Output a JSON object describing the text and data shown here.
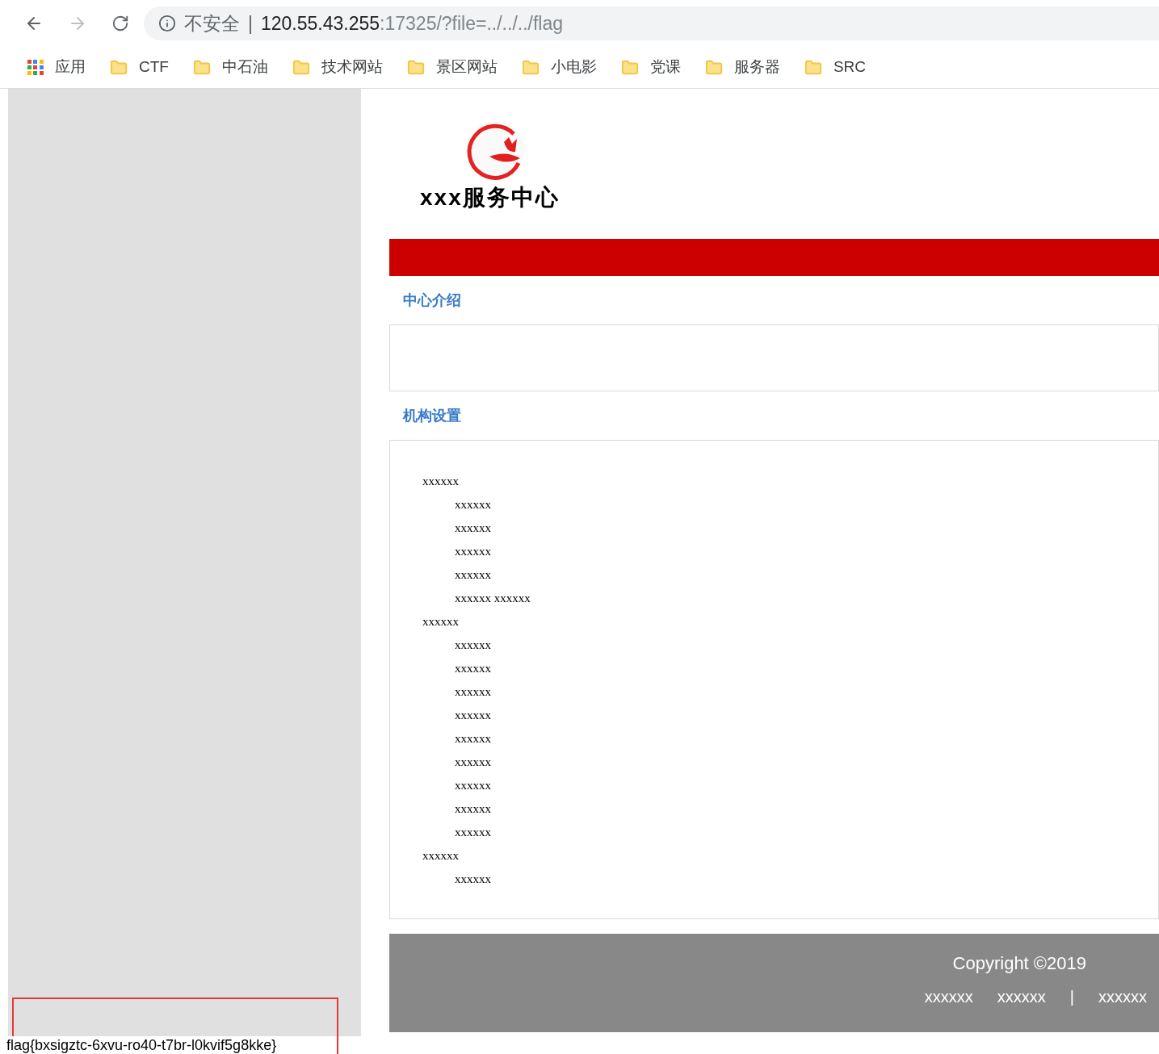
{
  "address_bar": {
    "security_label": "不安全",
    "separator": "|",
    "host": "120.55.43.255",
    "path": ":17325/?file=../../../flag"
  },
  "bookmarks": [
    {
      "label": "应用",
      "kind": "apps"
    },
    {
      "label": "CTF",
      "kind": "folder"
    },
    {
      "label": "中石油",
      "kind": "folder"
    },
    {
      "label": "技术网站",
      "kind": "folder"
    },
    {
      "label": "景区网站",
      "kind": "folder"
    },
    {
      "label": "小电影",
      "kind": "folder"
    },
    {
      "label": "党课",
      "kind": "folder"
    },
    {
      "label": "服务器",
      "kind": "folder"
    },
    {
      "label": "SRC",
      "kind": "folder"
    }
  ],
  "site": {
    "name": "xxx服务中心"
  },
  "sections": [
    {
      "title": "中心介绍"
    },
    {
      "title": "机构设置",
      "items": [
        {
          "label": "xxxxxx",
          "children": [
            {
              "label": "xxxxxx"
            },
            {
              "label": "xxxxxx"
            },
            {
              "label": "xxxxxx"
            },
            {
              "label": "xxxxxx"
            },
            {
              "label": "xxxxxx xxxxxx"
            }
          ]
        },
        {
          "label": "xxxxxx",
          "children": [
            {
              "label": "xxxxxx"
            },
            {
              "label": "xxxxxx"
            },
            {
              "label": "xxxxxx"
            },
            {
              "label": "xxxxxx"
            },
            {
              "label": "xxxxxx"
            },
            {
              "label": "xxxxxx"
            },
            {
              "label": "xxxxxx"
            },
            {
              "label": "xxxxxx"
            },
            {
              "label": "xxxxxx"
            }
          ]
        },
        {
          "label": "xxxxxx",
          "children": [
            {
              "label": "xxxxxx"
            }
          ]
        }
      ]
    }
  ],
  "footer": {
    "copyright": "Copyright ©2019",
    "links": [
      "xxxxxx",
      "xxxxxx",
      "|",
      "xxxxxx"
    ]
  },
  "output_text": "flag{bxsigztc-6xvu-ro40-t7br-l0kvif5g8kke}"
}
